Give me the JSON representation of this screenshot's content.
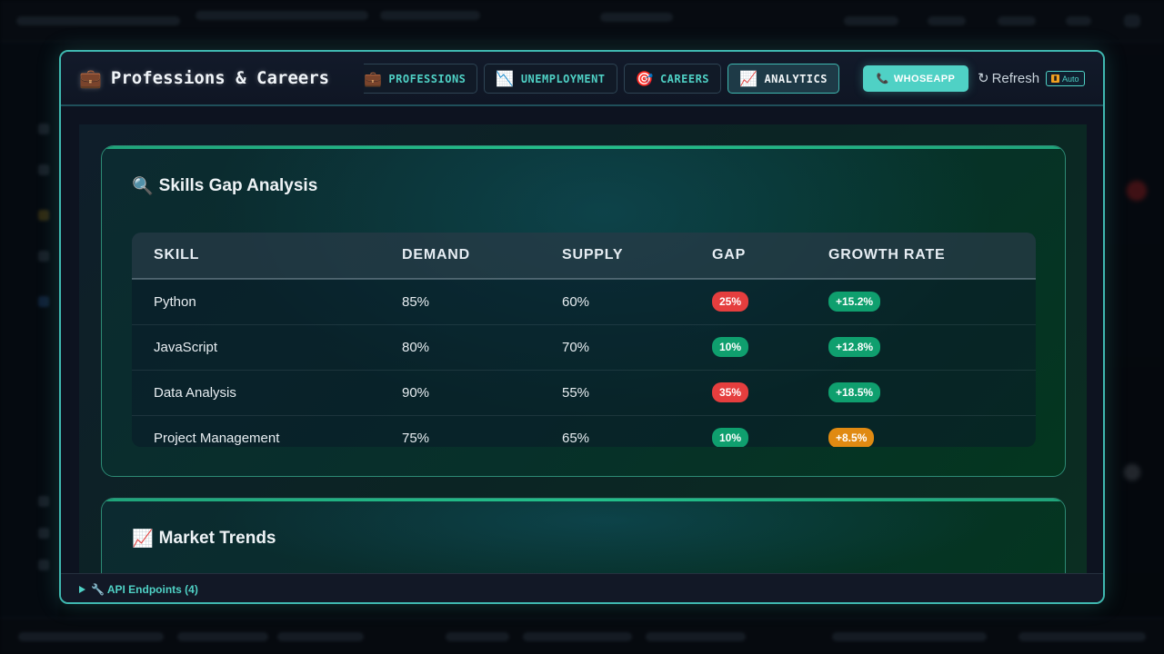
{
  "modal": {
    "title": "Professions & Careers",
    "title_icon": "briefcase-icon",
    "tabs": [
      {
        "label": "PROFESSIONS",
        "icon": "💼",
        "active": false
      },
      {
        "label": "UNEMPLOYMENT",
        "icon": "📉",
        "active": false
      },
      {
        "label": "CAREERS",
        "icon": "🎯",
        "active": false
      },
      {
        "label": "ANALYTICS",
        "icon": "📈",
        "active": true
      }
    ],
    "whoseapp_label": "WHOSEAPP",
    "refresh_label": "Refresh",
    "auto_label": "Auto"
  },
  "skills_gap": {
    "title": "Skills Gap Analysis",
    "columns": [
      "SKILL",
      "DEMAND",
      "SUPPLY",
      "GAP",
      "GROWTH RATE"
    ],
    "rows": [
      {
        "skill": "Python",
        "demand": "85%",
        "supply": "60%",
        "gap": "25%",
        "gap_color": "#e53e3e",
        "growth": "+15.2%",
        "growth_color": "#0f9f6e"
      },
      {
        "skill": "JavaScript",
        "demand": "80%",
        "supply": "70%",
        "gap": "10%",
        "gap_color": "#0f9f6e",
        "growth": "+12.8%",
        "growth_color": "#0f9f6e"
      },
      {
        "skill": "Data Analysis",
        "demand": "90%",
        "supply": "55%",
        "gap": "35%",
        "gap_color": "#e53e3e",
        "growth": "+18.5%",
        "growth_color": "#0f9f6e"
      },
      {
        "skill": "Project Management",
        "demand": "75%",
        "supply": "65%",
        "gap": "10%",
        "gap_color": "#0f9f6e",
        "growth": "+8.5%",
        "growth_color": "#e08a12"
      }
    ]
  },
  "market_trends": {
    "title": "Market Trends"
  },
  "footer": {
    "label": "🔧 API Endpoints (4)"
  },
  "colors": {
    "accent": "#4fd1c5",
    "danger": "#e53e3e",
    "success": "#0f9f6e",
    "warning": "#e08a12"
  }
}
